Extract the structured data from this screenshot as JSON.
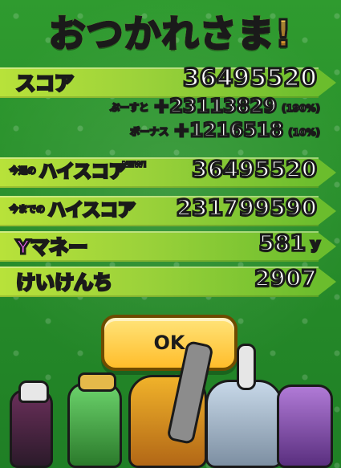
{
  "title": "おつかれさま!",
  "rows": {
    "score": {
      "label": "スコア",
      "value": "36495520"
    },
    "bonus1": {
      "label": "ぶーすと",
      "value": "+23113829",
      "pct": "(190%)"
    },
    "bonus2": {
      "label": "ボーナス",
      "value": "+1216518",
      "pct": "(10%)"
    },
    "weekly_high": {
      "label_small": "今週の",
      "label": "ハイスコア",
      "badge": "NEW!",
      "value": "36495520"
    },
    "all_time_high": {
      "label_small": "今までの",
      "label": "ハイスコア",
      "value": "231799590"
    },
    "money": {
      "label": "Yマネー",
      "value": "581",
      "unit": "y"
    },
    "exp": {
      "label": "けいけんち",
      "value": "2907"
    }
  },
  "button": {
    "label": "OK"
  },
  "colors": {
    "background": "#1f7f25",
    "band": "#9bd23a",
    "ok_button": "#ffbd2b",
    "label_pink": "#ff66ff",
    "label_cyan": "#63ddff"
  },
  "icons": {
    "ok": "ok-button",
    "characters": "yokai-characters"
  }
}
